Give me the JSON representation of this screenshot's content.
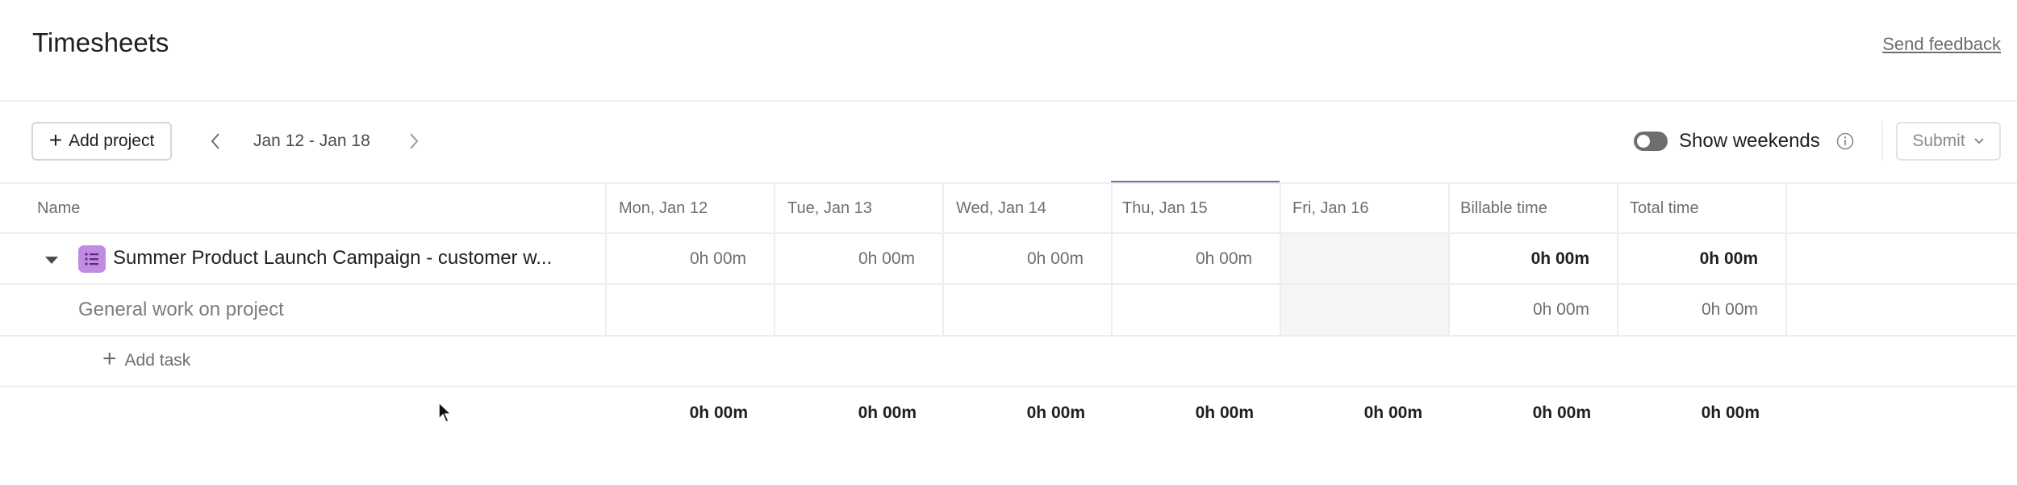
{
  "header": {
    "title": "Timesheets",
    "feedback_label": "Send feedback"
  },
  "toolbar": {
    "add_project_label": "Add project",
    "date_range": "Jan 12 - Jan 18",
    "show_weekends_label": "Show weekends",
    "show_weekends_on": false,
    "submit_label": "Submit"
  },
  "table": {
    "columns": [
      "Name",
      "Mon, Jan 12",
      "Tue, Jan 13",
      "Wed, Jan 14",
      "Thu, Jan 15",
      "Fri, Jan 16",
      "Billable time",
      "Total time"
    ],
    "project": {
      "name": "Summer Product Launch Campaign - customer w...",
      "days": [
        "0h 00m",
        "0h 00m",
        "0h 00m",
        "0h 00m",
        ""
      ],
      "billable": "0h 00m",
      "total": "0h 00m"
    },
    "task": {
      "name": "General work on project",
      "days": [
        "",
        "",
        "",
        "",
        ""
      ],
      "billable": "0h 00m",
      "total": "0h 00m"
    },
    "add_task_label": "Add task",
    "totals": [
      "0h 00m",
      "0h 00m",
      "0h 00m",
      "0h 00m",
      "0h 00m",
      "0h 00m",
      "0h 00m"
    ]
  },
  "colors": {
    "today_indicator": "#6770b8",
    "project_icon": "#c08be0"
  },
  "icons": [
    "plus-icon",
    "chevron-left-icon",
    "chevron-right-icon",
    "info-icon",
    "chevron-down-icon",
    "caret-down-icon",
    "project-list-icon",
    "mouse-cursor-icon"
  ]
}
